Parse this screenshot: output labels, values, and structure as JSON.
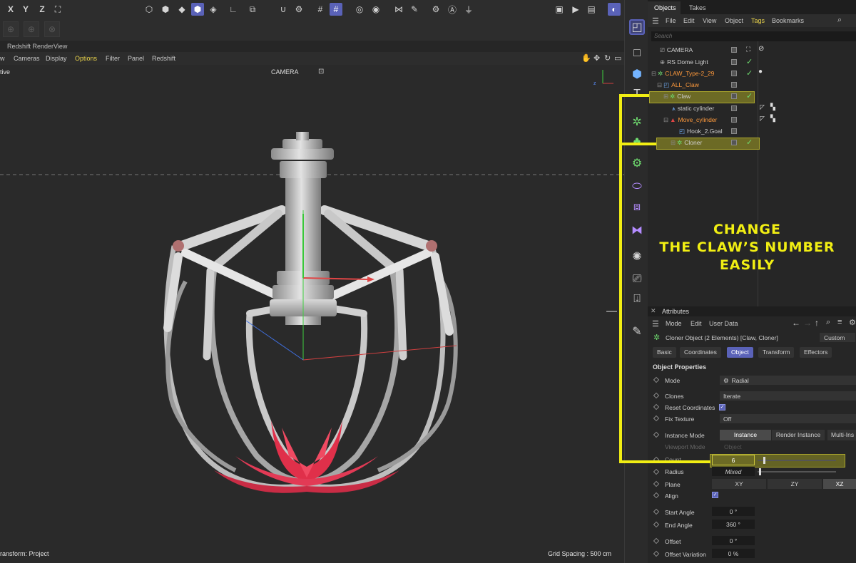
{
  "toolbar": {
    "axes": [
      "X",
      "Y",
      "Z"
    ]
  },
  "viewport": {
    "window_title": "Redshift RenderView",
    "menu": [
      "w",
      "Cameras",
      "Display",
      "Options",
      "Filter",
      "Panel",
      "Redshift"
    ],
    "highlighted_menu": "Options",
    "view_label": "tive",
    "camera_label": "CAMERA",
    "status_left": "ransform: Project",
    "status_right": "Grid Spacing : 500 cm"
  },
  "objects_panel": {
    "tabs": [
      "Objects",
      "Takes"
    ],
    "menu": [
      "File",
      "Edit",
      "View",
      "Object",
      "Tags",
      "Bookmarks"
    ],
    "highlighted_menu": "Tags",
    "search_placeholder": "Search",
    "tree": [
      {
        "name": "CAMERA",
        "icon": "camera-icon",
        "color": "normal"
      },
      {
        "name": "RS Dome Light",
        "icon": "globe-icon",
        "color": "normal"
      },
      {
        "name": "CLAW_Type-2_29",
        "icon": "cloner-icon",
        "color": "orange"
      },
      {
        "name": "ALL_Claw",
        "icon": "null-icon",
        "color": "orange"
      },
      {
        "name": "Claw",
        "icon": "cloner-icon",
        "color": "normal",
        "highlighted": true
      },
      {
        "name": "static cylinder",
        "icon": "joint-icon",
        "color": "normal"
      },
      {
        "name": "Move_cylinder",
        "icon": "joint-icon",
        "color": "orange"
      },
      {
        "name": "Hook_2.Goal",
        "icon": "null-icon",
        "color": "normal"
      },
      {
        "name": "Cloner",
        "icon": "cloner-icon",
        "color": "normal",
        "highlighted": true
      }
    ]
  },
  "attributes_panel": {
    "title": "Attributes",
    "menu": [
      "Mode",
      "Edit",
      "User Data"
    ],
    "subtitle": "Cloner Object (2 Elements) [Claw, Cloner]",
    "custom_label": "Custom",
    "tabs": [
      "Basic",
      "Coordinates",
      "Object",
      "Transform",
      "Effectors"
    ],
    "selected_tab": "Object",
    "section_title": "Object Properties",
    "props": {
      "mode": {
        "label": "Mode",
        "value": "Radial"
      },
      "clones": {
        "label": "Clones",
        "value": "Iterate"
      },
      "reset_coords": {
        "label": "Reset Coordinates",
        "checked": true
      },
      "fix_texture": {
        "label": "Fix Texture",
        "value": "Off"
      },
      "instance_mode": {
        "label": "Instance Mode",
        "options": [
          "Instance",
          "Render Instance",
          "Multi-Ins"
        ],
        "selected": "Instance"
      },
      "viewport_mode": {
        "label": "Viewport Mode",
        "value": "Object"
      },
      "count": {
        "label": "Count",
        "value": "6"
      },
      "radius": {
        "label": "Radius",
        "value": "Mixed"
      },
      "plane": {
        "label": "Plane",
        "options": [
          "XY",
          "ZY",
          "XZ"
        ],
        "selected": "XZ"
      },
      "align": {
        "label": "Align",
        "checked": true
      },
      "start_angle": {
        "label": "Start Angle",
        "value": "0 °"
      },
      "end_angle": {
        "label": "End Angle",
        "value": "360 °"
      },
      "offset": {
        "label": "Offset",
        "value": "0 °"
      },
      "offset_variation": {
        "label": "Offset Variation",
        "value": "0 %"
      }
    }
  },
  "annotation": {
    "lines": [
      "CHANGE",
      "THE CLAW’S NUMBER",
      "EASILY"
    ],
    "color": "#f1ee13"
  }
}
